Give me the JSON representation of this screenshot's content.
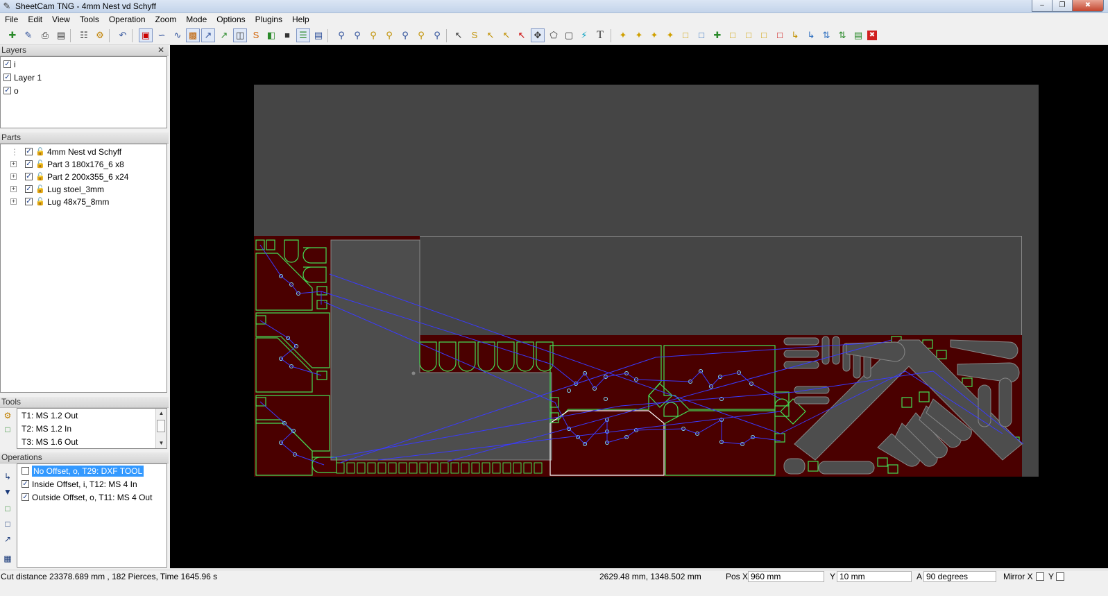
{
  "window": {
    "title": "SheetCam TNG - 4mm Nest vd Schyff",
    "app_icon": "sheetcam-icon",
    "minimize": "‒",
    "maximize": "❐",
    "close": "✖"
  },
  "menu": [
    "File",
    "Edit",
    "View",
    "Tools",
    "Operation",
    "Zoom",
    "Mode",
    "Options",
    "Plugins",
    "Help"
  ],
  "layers": {
    "header": "Layers",
    "close": "✕",
    "items": [
      {
        "label": "i",
        "checked": true
      },
      {
        "label": "Layer 1",
        "checked": true
      },
      {
        "label": "o",
        "checked": true
      }
    ]
  },
  "parts": {
    "header": "Parts",
    "items": [
      {
        "label": "4mm Nest vd Schyff",
        "checked": true,
        "expandable": false
      },
      {
        "label": "Part 3 180x176_6 x8",
        "checked": true,
        "expandable": true
      },
      {
        "label": "Part 2 200x355_6 x24",
        "checked": true,
        "expandable": true
      },
      {
        "label": "Lug stoel_3mm",
        "checked": true,
        "expandable": true
      },
      {
        "label": "Lug 48x75_8mm",
        "checked": true,
        "expandable": true
      }
    ]
  },
  "tools": {
    "header": "Tools",
    "items": [
      "T1: MS 1.2 Out",
      "T2: MS 1.2 In",
      "T3: MS 1.6 Out"
    ]
  },
  "operations": {
    "header": "Operations",
    "items": [
      {
        "label": "No Offset, o, T29: DXF TOOL",
        "checked": false,
        "selected": true
      },
      {
        "label": "Inside Offset, i, T12: MS 4 In",
        "checked": true,
        "selected": false
      },
      {
        "label": "Outside Offset, o, T11: MS 4 Out",
        "checked": true,
        "selected": false
      }
    ]
  },
  "status": {
    "cut_info": "Cut distance 23378.689 mm , 182 Pierces, Time 1645.96 s",
    "cursor": "2629.48 mm, 1348.502 mm",
    "posx_label": "Pos X",
    "posx_value": "960 mm",
    "y_label": "Y",
    "y_value": "10 mm",
    "a_label": "A",
    "a_value": "90 degrees",
    "mirrorx_label": "Mirror X",
    "mirrory_label": "Y"
  },
  "colors": {
    "sheet": "#454545",
    "material": "#4a0000",
    "part_outline": "#44dd55",
    "rapid": "#3a3aff",
    "selected_op": "#3399ff"
  }
}
